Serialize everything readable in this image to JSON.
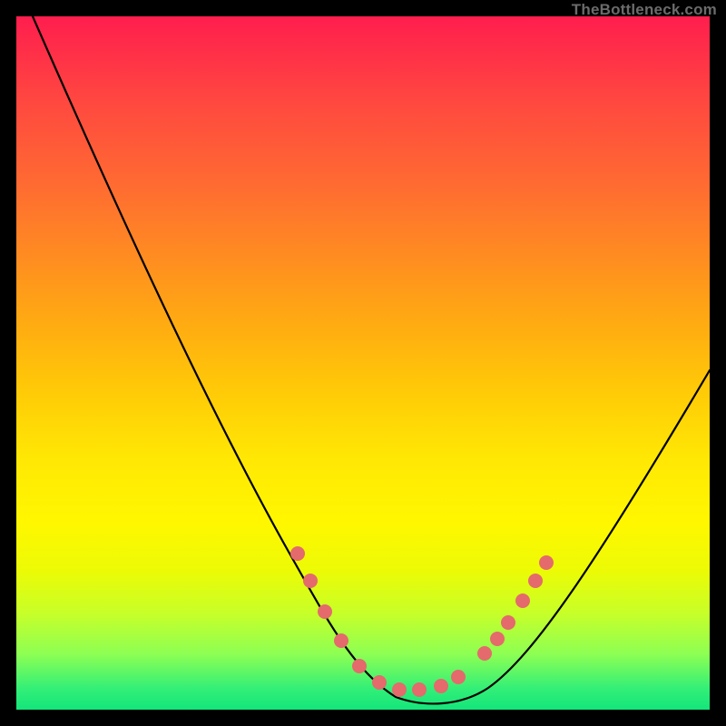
{
  "brand": "TheBottleneck.com",
  "chart_data": {
    "type": "line",
    "title": "",
    "xlabel": "",
    "ylabel": "",
    "xlim": [
      0,
      100
    ],
    "ylim": [
      0,
      100
    ],
    "grid": false,
    "legend_position": "none",
    "series": [
      {
        "name": "bottleneck-curve",
        "x": [
          0,
          5,
          10,
          15,
          20,
          25,
          30,
          35,
          40,
          42,
          45,
          50,
          54,
          58,
          62,
          65,
          70,
          75,
          80,
          85,
          90,
          95,
          100
        ],
        "y": [
          100,
          91,
          82,
          73,
          64,
          54,
          44,
          33,
          22,
          16,
          10,
          4,
          1,
          0,
          0,
          1,
          5,
          12,
          20,
          28,
          35,
          42,
          49
        ]
      }
    ],
    "markers": {
      "name": "highlight-points",
      "color": "#e46a6c",
      "x": [
        40,
        42,
        45,
        47,
        50,
        53,
        55,
        58,
        62,
        65,
        67,
        70
      ],
      "y": [
        22,
        16,
        10,
        7,
        4,
        2,
        1,
        0,
        0,
        1,
        3,
        5
      ]
    },
    "colors": {
      "curve": "#000000",
      "gradient_top": "#ff1e4e",
      "gradient_mid": "#ffe804",
      "gradient_bottom": "#14e57b",
      "frame": "#000000"
    }
  }
}
